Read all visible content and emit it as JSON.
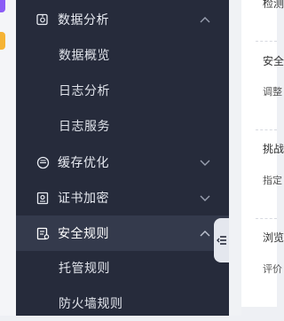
{
  "sidebar": {
    "groups": [
      {
        "label": "数据分析",
        "icon": "data-analysis-icon",
        "state": "expanded"
      },
      {
        "label": "缓存优化",
        "icon": "cache-icon",
        "state": "collapsed"
      },
      {
        "label": "证书加密",
        "icon": "certificate-icon",
        "state": "collapsed"
      },
      {
        "label": "安全规则",
        "icon": "security-rule-icon",
        "state": "expanded"
      }
    ],
    "data_analysis_items": [
      "数据概览",
      "日志分析",
      "日志服务"
    ],
    "security_rule_items": [
      "托管规则",
      "防火墙规则"
    ]
  },
  "panel": {
    "texts": [
      "检测",
      "安全",
      "调整",
      "挑战",
      "指定",
      "浏览",
      "评价"
    ]
  },
  "colors": {
    "sidebar_bg": "#262b3b",
    "active_bg": "#343a4c",
    "accent_tags": [
      "#8b5cf6",
      "#f5b335"
    ]
  }
}
